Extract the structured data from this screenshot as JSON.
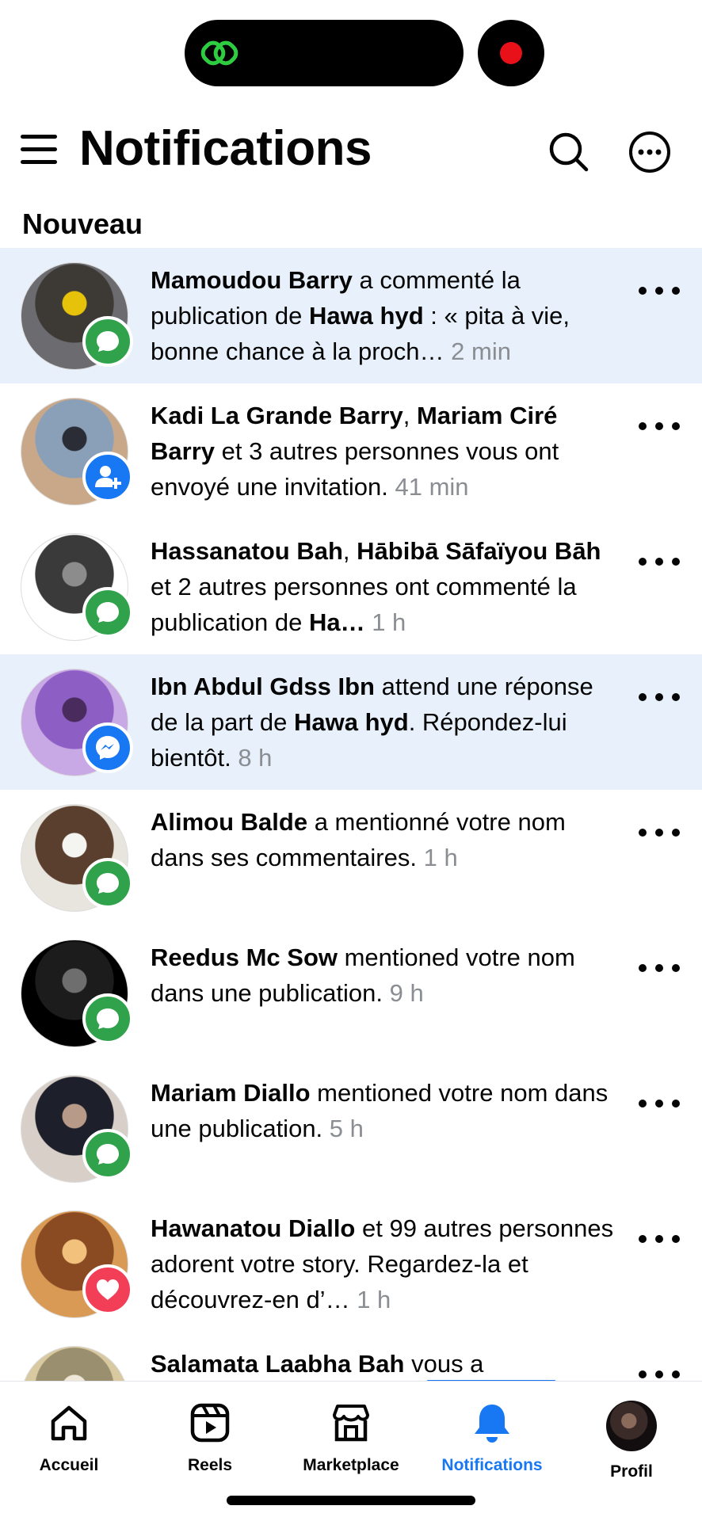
{
  "header": {
    "title": "Notifications"
  },
  "section": {
    "title": "Nouveau"
  },
  "notifications": [
    {
      "segments": [
        {
          "t": "Mamoudou Barry",
          "b": true
        },
        {
          "t": " a commenté la publication de "
        },
        {
          "t": "Hawa hyd",
          "b": true
        },
        {
          "t": " : « pita à vie, bonne chance à la proch…"
        }
      ],
      "time": "2 min",
      "badge": "comment",
      "unread": true,
      "avatar": [
        "#6b6b70",
        "#3d3a36",
        "#e6c20b"
      ]
    },
    {
      "segments": [
        {
          "t": "Kadi La Grande Barry",
          "b": true
        },
        {
          "t": ", "
        },
        {
          "t": "Mariam Ciré Barry",
          "b": true
        },
        {
          "t": " et 3 autres personnes vous ont envoyé une invitation."
        }
      ],
      "time": "41 min",
      "badge": "friend",
      "unread": false,
      "avatar": [
        "#c8a889",
        "#8aa0b8",
        "#2a2d36"
      ]
    },
    {
      "segments": [
        {
          "t": "Hassanatou Bah",
          "b": true
        },
        {
          "t": ", "
        },
        {
          "t": "Hābibā Sāfaïyou Bāh",
          "b": true
        },
        {
          "t": " et 2 autres personnes ont commenté la publication de "
        },
        {
          "t": "Ha…",
          "b": true
        }
      ],
      "time": "1 h",
      "badge": "comment",
      "unread": false,
      "avatar": [
        "#ffffff",
        "#3a3a3a",
        "#8c8c8c"
      ]
    },
    {
      "segments": [
        {
          "t": "Ibn Abdul Gdss Ibn",
          "b": true
        },
        {
          "t": " attend une réponse de la part de "
        },
        {
          "t": "Hawa hyd",
          "b": true
        },
        {
          "t": ". Répondez-lui bientôt."
        }
      ],
      "time": "8 h",
      "badge": "messenger",
      "unread": true,
      "avatar": [
        "#c9a8e6",
        "#8d5fc4",
        "#4a2b5e"
      ]
    },
    {
      "segments": [
        {
          "t": "Alimou Balde",
          "b": true
        },
        {
          "t": " a mentionné votre nom dans ses commentaires."
        }
      ],
      "time": "1 h",
      "badge": "comment",
      "unread": false,
      "avatar": [
        "#e8e5df",
        "#5a3e2e",
        "#f4f4f0"
      ]
    },
    {
      "segments": [
        {
          "t": "Reedus Mc Sow",
          "b": true
        },
        {
          "t": " mentioned votre nom dans une publication."
        }
      ],
      "time": "9 h",
      "badge": "comment",
      "unread": false,
      "avatar": [
        "#000000",
        "#1c1c1c",
        "#6e6e6e"
      ]
    },
    {
      "segments": [
        {
          "t": "Mariam Diallo",
          "b": true
        },
        {
          "t": " mentioned votre nom dans une publication."
        }
      ],
      "time": "5 h",
      "badge": "comment",
      "unread": false,
      "avatar": [
        "#d8cfc8",
        "#1d1f2b",
        "#b89a88"
      ]
    },
    {
      "segments": [
        {
          "t": "Hawanatou Diallo",
          "b": true
        },
        {
          "t": " et 99 autres personnes adorent votre story. Regardez-la et découvrez-en d’…"
        }
      ],
      "time": "1 h",
      "badge": "love",
      "unread": false,
      "avatar": [
        "#d99a55",
        "#8a4b22",
        "#f2c27c"
      ]
    },
    {
      "segments": [
        {
          "t": "Salamata Laabha Bah",
          "b": true
        },
        {
          "t": " vous a"
        }
      ],
      "time": "",
      "badge": "comment",
      "unread": false,
      "avatar": [
        "#d8c9a0",
        "#9a8f6e",
        "#efe8d8"
      ]
    }
  ],
  "nav": {
    "home": "Accueil",
    "reels": "Reels",
    "marketplace": "Marketplace",
    "notifications": "Notifications",
    "profile": "Profil"
  },
  "colors": {
    "accent": "#1877f2",
    "unread_bg": "#e7f0fb",
    "comment_badge": "#31a24c",
    "love_badge": "#f33e58",
    "record_dot": "#e8111a",
    "island_icon": "#2ecc40"
  }
}
